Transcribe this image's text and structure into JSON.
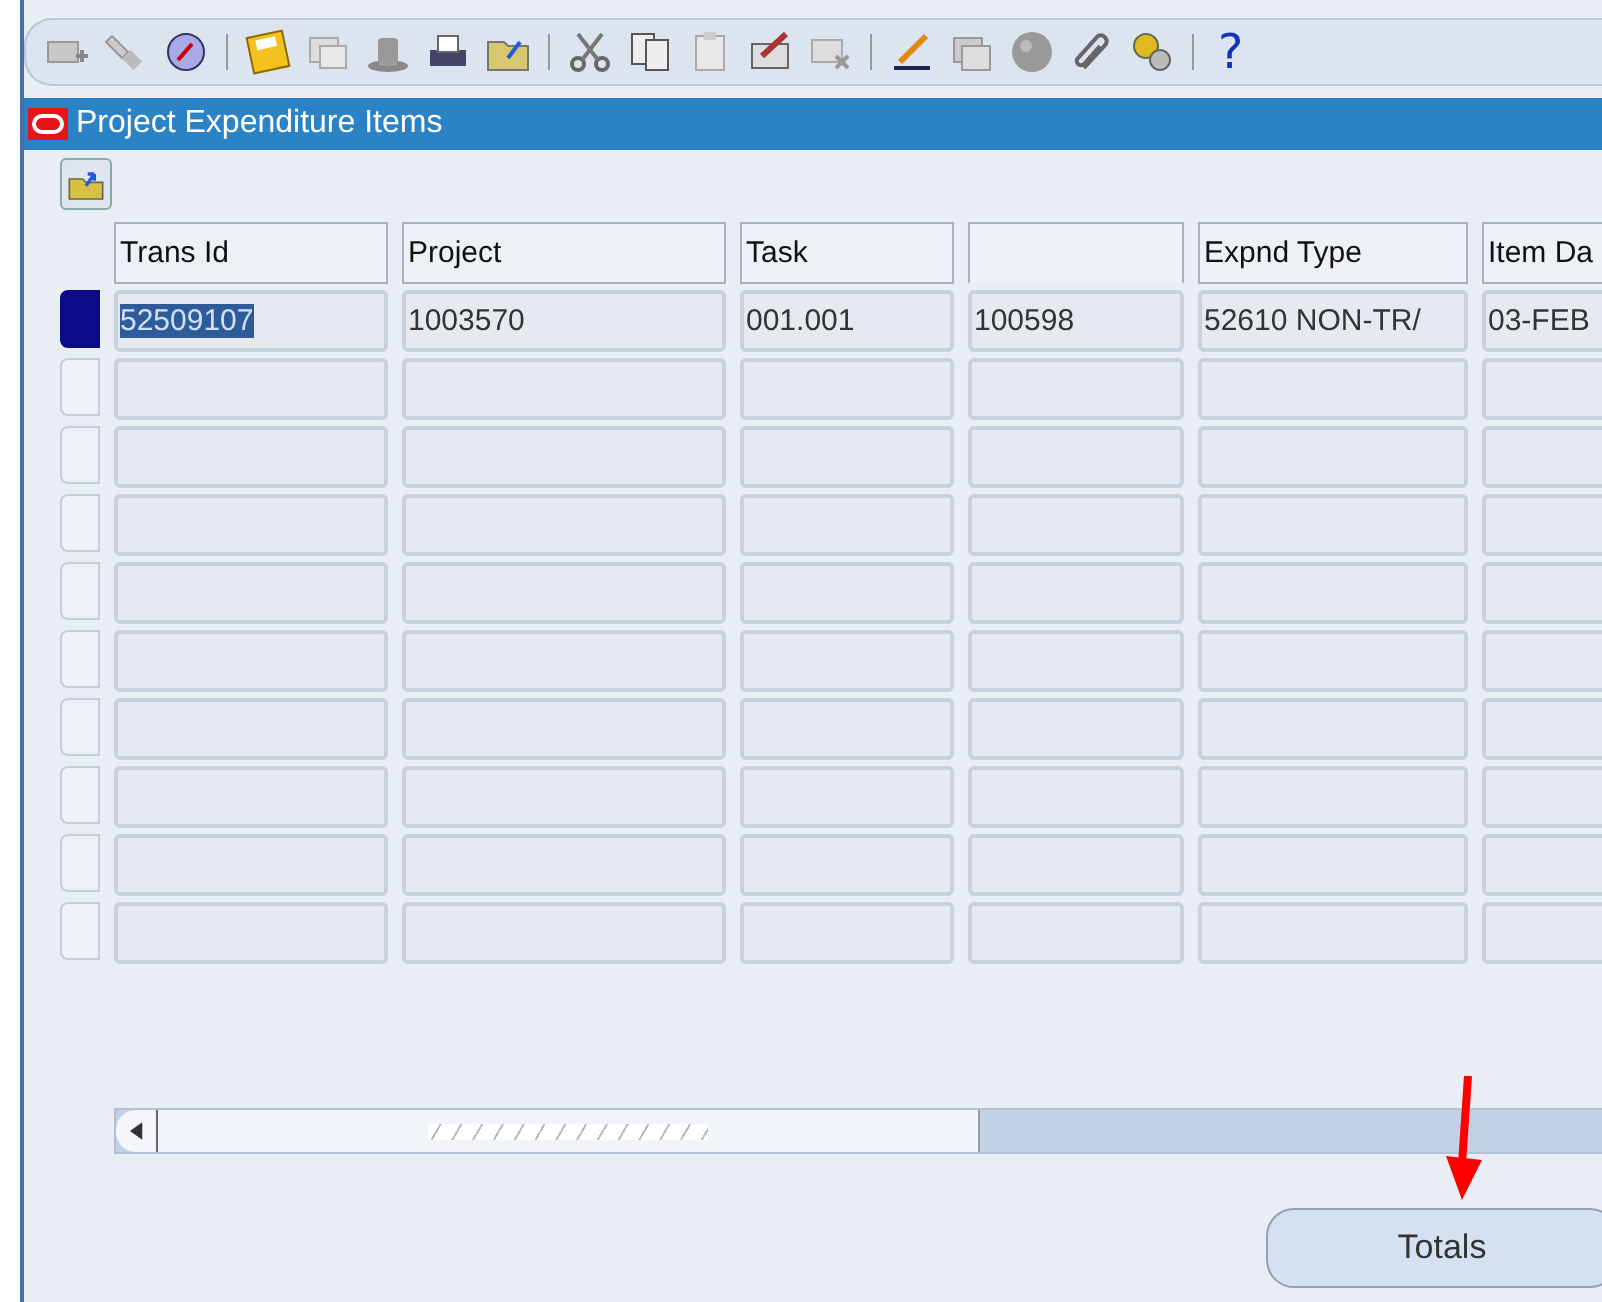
{
  "toolbar": {
    "items": [
      {
        "kind": "icon"
      },
      {
        "kind": "icon"
      },
      {
        "kind": "icon"
      },
      {
        "kind": "sep"
      },
      {
        "kind": "icon"
      },
      {
        "kind": "icon"
      },
      {
        "kind": "icon"
      },
      {
        "kind": "icon"
      },
      {
        "kind": "icon"
      },
      {
        "kind": "sep"
      },
      {
        "kind": "icon"
      },
      {
        "kind": "icon"
      },
      {
        "kind": "icon"
      },
      {
        "kind": "icon"
      },
      {
        "kind": "icon"
      },
      {
        "kind": "sep"
      },
      {
        "kind": "icon"
      },
      {
        "kind": "icon"
      },
      {
        "kind": "icon"
      },
      {
        "kind": "icon"
      },
      {
        "kind": "icon"
      },
      {
        "kind": "sep"
      },
      {
        "kind": "help",
        "label": "?"
      }
    ]
  },
  "window": {
    "title": "Project Expenditure Items"
  },
  "table": {
    "columns": [
      {
        "label": "Trans Id"
      },
      {
        "label": "Project"
      },
      {
        "label": "Task"
      },
      {},
      {
        "label": "Expnd Type"
      },
      {
        "label": "Item Da"
      }
    ],
    "rows": [
      {
        "selected": true,
        "cells": [
          "52509107",
          "1003570",
          "001.001",
          "100598",
          "52610 NON-TR/",
          "03-FEB"
        ]
      },
      {
        "selected": false
      },
      {
        "selected": false
      },
      {
        "selected": false
      },
      {
        "selected": false
      },
      {
        "selected": false
      },
      {
        "selected": false
      },
      {
        "selected": false
      },
      {
        "selected": false
      },
      {
        "selected": false
      }
    ]
  },
  "buttons": [
    {
      "label": "Totals"
    }
  ]
}
